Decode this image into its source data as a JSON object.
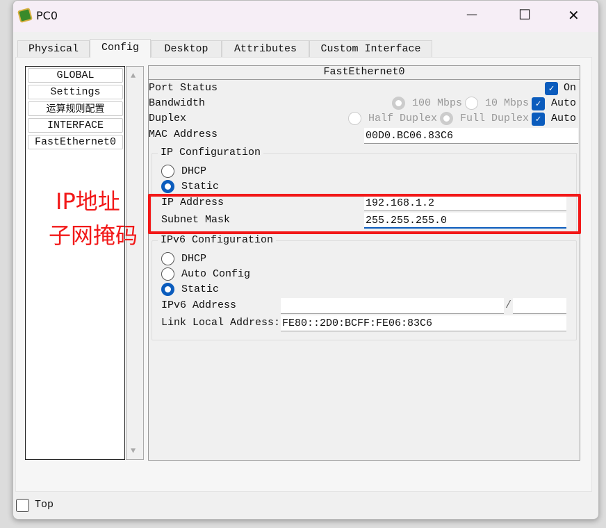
{
  "window": {
    "title": "PC0",
    "icon": "packet-tracer-pc-icon",
    "minimize": "—",
    "maximize": "☐",
    "close": "✕"
  },
  "tabs": [
    {
      "label": "Physical"
    },
    {
      "label": "Config",
      "selected": true
    },
    {
      "label": "Desktop"
    },
    {
      "label": "Attributes"
    },
    {
      "label": "Custom Interface"
    }
  ],
  "sidebar": {
    "items": [
      {
        "label": "GLOBAL"
      },
      {
        "label": "Settings"
      },
      {
        "label": "运算规则配置"
      },
      {
        "label": "INTERFACE"
      },
      {
        "label": "FastEthernet0"
      }
    ]
  },
  "interface": {
    "title": "FastEthernet0",
    "port_status": {
      "label": "Port Status",
      "on_label": "On",
      "checked": true
    },
    "bandwidth": {
      "label": "Bandwidth",
      "opt100": "100 Mbps",
      "opt10": "10 Mbps",
      "auto": "Auto",
      "auto_checked": true
    },
    "duplex": {
      "label": "Duplex",
      "half": "Half Duplex",
      "full": "Full Duplex",
      "auto": "Auto",
      "auto_checked": true
    },
    "mac": {
      "label": "MAC Address",
      "value": "00D0.BC06.83C6"
    },
    "ip_config": {
      "legend": "IP Configuration",
      "dhcp": "DHCP",
      "static": "Static",
      "selected": "Static",
      "ip_label": "IP Address",
      "ip_value": "192.168.1.2",
      "mask_label": "Subnet Mask",
      "mask_value": "255.255.255.0"
    },
    "ipv6_config": {
      "legend": "IPv6 Configuration",
      "dhcp": "DHCP",
      "auto": "Auto Config",
      "static": "Static",
      "selected": "Static",
      "addr_label": "IPv6 Address",
      "addr_value": "",
      "slash": "/",
      "prefix_value": "",
      "link_local_label": "Link Local Address:",
      "link_local_value": "FE80::2D0:BCFF:FE06:83C6"
    }
  },
  "annotation": {
    "line1": "IP地址",
    "line2": "子网掩码",
    "color": "#f21818"
  },
  "footer": {
    "top_label": "Top",
    "top_checked": false
  },
  "colors": {
    "accent": "#0b5cbd",
    "highlight": "#f21818"
  }
}
